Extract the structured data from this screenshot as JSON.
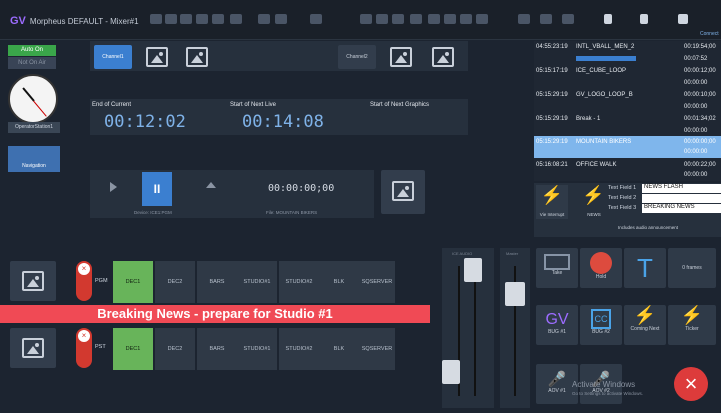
{
  "header": {
    "app": "Morpheus DEFAULT - Mixer#1",
    "conn": "Connect"
  },
  "toolbar": [
    "Lock",
    "Time",
    "Grab",
    "Seq",
    "Source",
    "Update",
    "Audio",
    "Undo",
    "Redo",
    "Play",
    "Key",
    "Page"
  ],
  "left": {
    "auto_on": "Auto On",
    "not_on_air": "Not On Air",
    "station": "OperatorStation1",
    "nav": "Navigation"
  },
  "channels": {
    "ch1": "Channel1",
    "ch2": "Channel2"
  },
  "timers": {
    "end_label": "End of Current",
    "end_value": "00:12:02",
    "next_label": "Start of Next Live",
    "next_value": "00:14:08",
    "graphics_label": "Start of Next Graphics"
  },
  "transport": {
    "timecode": "00:00:00;00",
    "device": "Device: ICE1:PGM",
    "file": "File: MOUNTAIN BIKERS"
  },
  "pgm": {
    "label": "PGM",
    "sources": [
      "DEC1",
      "DEC2",
      "BARS",
      "STUDIO#1",
      "STUDIO#2",
      "BLK",
      "SQSERVER"
    ]
  },
  "pst": {
    "label": "PST",
    "sources": [
      "DEC1",
      "DEC2",
      "BARS",
      "STUDIO#1",
      "STUDIO#2",
      "BLK",
      "SQSERVER"
    ]
  },
  "banner": "Breaking News - prepare for Studio #1",
  "faders": {
    "ice": "ICE AUDIO",
    "master": "Master"
  },
  "playlist": [
    {
      "t": "04:55:23:19",
      "name": "INTL_VBALL_MEN_2",
      "a": "00:19:54;00",
      "b": "00:07:52"
    },
    {
      "t": "05:15:17:19",
      "name": "ICE_CUBE_LOOP",
      "a": "00:00:12;00",
      "b": "00:00:00"
    },
    {
      "t": "05:15:29:19",
      "name": "GV_LOGO_LOOP_B",
      "a": "00:00:10;00",
      "b": "00:00:00"
    },
    {
      "t": "05:15:29:19",
      "name": "Break - 1",
      "a": "00:01:34;02",
      "b": "00:00:00"
    },
    {
      "t": "05:15:29:19",
      "name": "MOUNTAIN BIKERS",
      "a": "00:00:00;00",
      "b": "00:00:00"
    },
    {
      "t": "05:16:08:21",
      "name": "OFFICE WALK",
      "a": "00:00:22;00",
      "b": "00:00:00"
    }
  ],
  "text_fields": {
    "l1": "Text Field 1",
    "v1": "NEWS FLASH",
    "l2": "Text Field 2",
    "v2": "",
    "l3": "Text Field 3",
    "v3": "BREAKING NEWS",
    "note": "Includes audio announcement",
    "vi": "Vie Interrupt",
    "news": "NEWS"
  },
  "macros": {
    "take": "Take",
    "hold": "Hold",
    "frames": "0 frames",
    "bug1": "BUG #1",
    "bug2": "BUG #2",
    "coming": "Coming Next",
    "ticker": "Ticker",
    "aov1": "AOV #1",
    "aov2": "AOV #2"
  },
  "watermark": {
    "l1": "Activate Windows",
    "l2": "Go to Settings to activate Windows."
  }
}
